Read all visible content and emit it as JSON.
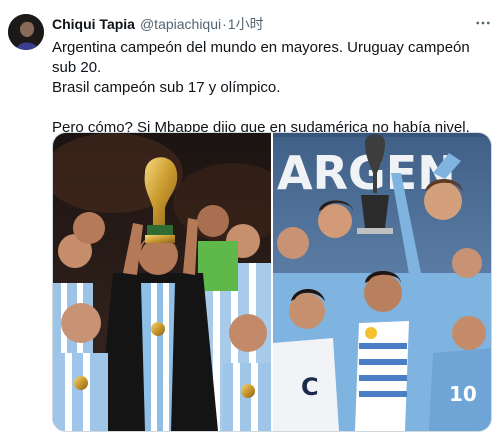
{
  "tweet": {
    "display_name": "Chiqui Tapia",
    "handle": "@tapiachiqui",
    "separator": "·",
    "time": "1小时",
    "more_icon": "more-horizontal-icon",
    "lines": [
      "Argentina campeón del mundo en mayores. Uruguay campeón sub 20.",
      "Brasil campeón sub 17 y olímpico.",
      "",
      "Pero cómo? Si Mbappe dijo que en sudamérica no había nivel."
    ]
  },
  "media": {
    "right_banner_text": "ARGEN",
    "jersey_numbers": [
      "C",
      "10"
    ]
  },
  "colors": {
    "text": "#0f1419",
    "secondary": "#536471",
    "border": "#cfd9de",
    "argentina_blue": "#75aadb",
    "uruguay_blue": "#7fb3e0"
  }
}
